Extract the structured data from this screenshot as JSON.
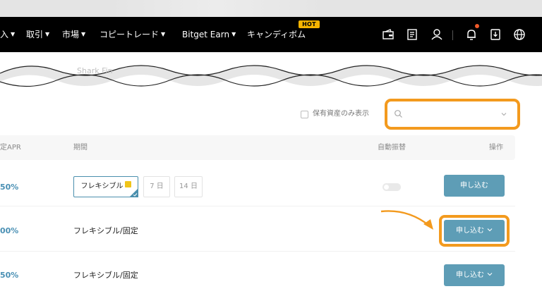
{
  "nav": {
    "items": [
      {
        "label": "入",
        "has_caret": true
      },
      {
        "label": "取引",
        "has_caret": true
      },
      {
        "label": "市場",
        "has_caret": true
      },
      {
        "label": "コピートレード",
        "has_caret": true
      },
      {
        "label": "Bitget Earn",
        "has_caret": true
      },
      {
        "label": "キャンディボム",
        "has_caret": false
      }
    ],
    "hot_badge": "HOT",
    "icons": [
      "wallet-icon",
      "orders-icon",
      "user-icon",
      "bell-icon",
      "download-icon",
      "globe-icon"
    ],
    "notification_color": "#f05a2a"
  },
  "breadcrumb": "Shark Fin",
  "filter": {
    "checkbox_label": "保有資産のみ表示",
    "search_placeholder": "",
    "search_value": ""
  },
  "table": {
    "headers": {
      "apr": "定APR",
      "period": "期間",
      "auto": "自動振替",
      "action": "操作"
    },
    "rows": [
      {
        "apr": "50%",
        "period_chips": [
          "フレキシブル",
          "7 日",
          "14 日"
        ],
        "active_chip_badge": "",
        "auto_transfer": false,
        "button_label": "申し込む"
      },
      {
        "apr": "00%",
        "period_text": "フレキシブル/固定",
        "button_label": "申し込む"
      },
      {
        "apr": "50%",
        "period_text": "フレキシブル/固定",
        "button_label": "申し込む"
      }
    ]
  },
  "colors": {
    "accent": "#5e9db6",
    "highlight": "#f39a1e",
    "apr_text": "#4a90b4"
  }
}
